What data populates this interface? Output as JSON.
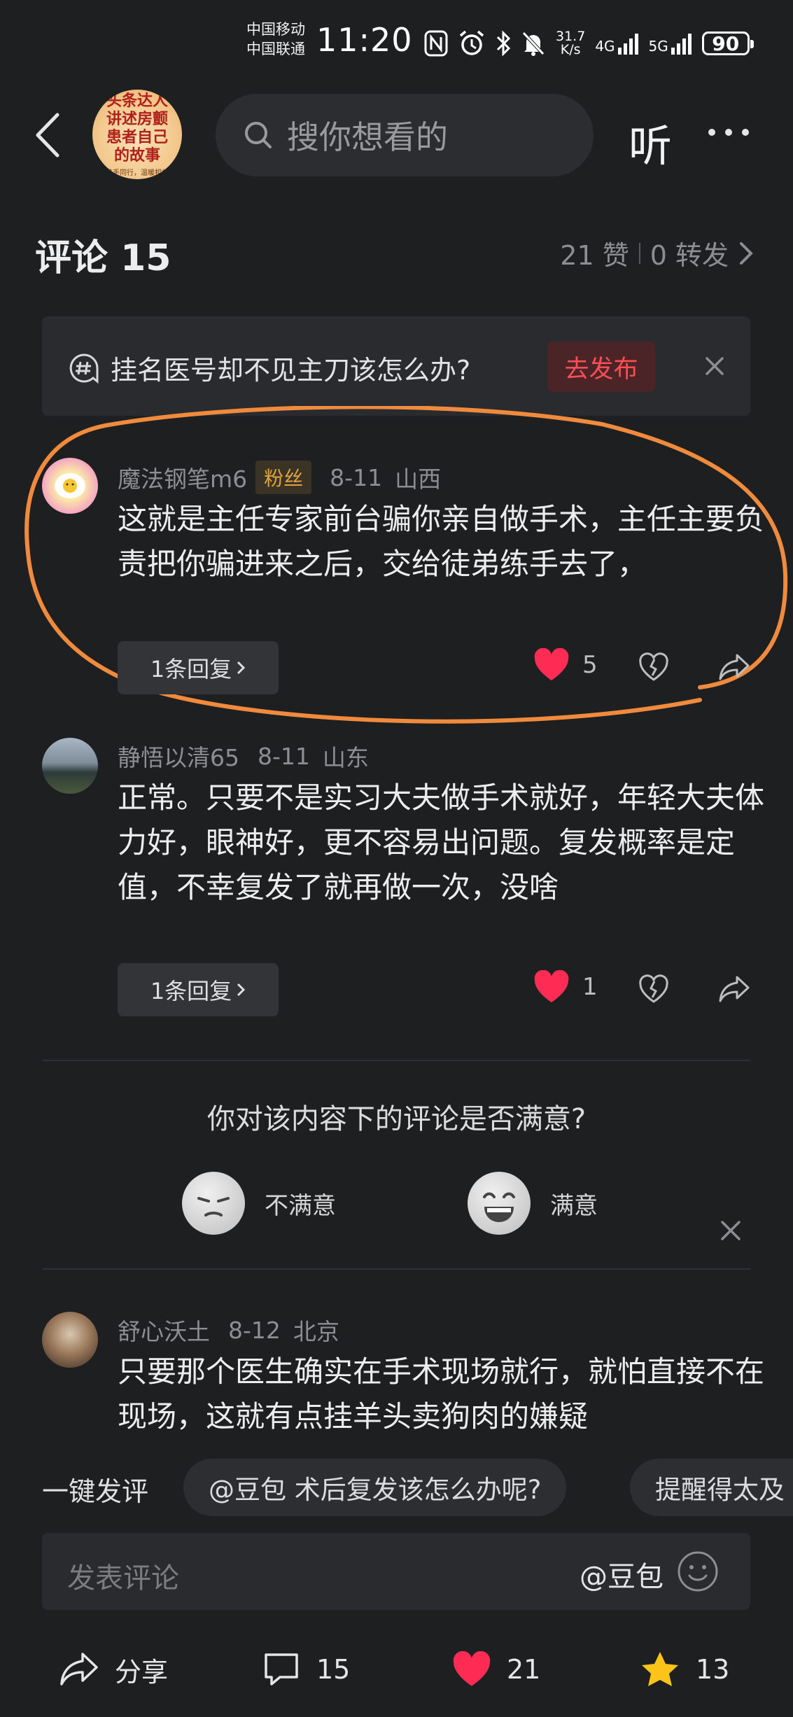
{
  "status_bar": {
    "carrier_1": "中国移动",
    "carrier_2": "中国联通",
    "time": "11:20",
    "net_speed_value": "31.7",
    "net_speed_unit": "K/s",
    "net_type_1": "4G",
    "net_type_2": "5G",
    "battery": "90"
  },
  "header": {
    "cover_title": "头条达人讲述房颤患者自己的故事",
    "cover_subtitle": "携手同行，温暖相伴",
    "search_placeholder": "搜你想看的",
    "listen_label": "听"
  },
  "comments_header": {
    "title": "评论 15",
    "likes": "21 赞",
    "reposts": "0 转发"
  },
  "prompt": {
    "text": "挂名医号却不见主刀该怎么办?",
    "publish_label": "去发布"
  },
  "comments": [
    {
      "user": "魔法钢笔m6",
      "badge": "粉丝",
      "date": "8-11",
      "location": "山西",
      "text": "这就是主任专家前台骗你亲自做手术，主任主要负责把你骗进来之后，交给徒弟练手去了，",
      "reply_label": "1条回复",
      "likes": "5"
    },
    {
      "user": "静悟以清65",
      "date": "8-11",
      "location": "山东",
      "text": "正常。只要不是实习大夫做手术就好，年轻大夫体力好，眼神好，更不容易出问题。复发概率是定值，不幸复发了就再做一次，没啥",
      "reply_label": "1条回复",
      "likes": "1"
    },
    {
      "user": "舒心沃土",
      "date": "8-12",
      "location": "北京",
      "text": "只要那个医生确实在手术现场就行，就怕直接不在现场，这就有点挂羊头卖狗肉的嫌疑"
    }
  ],
  "survey": {
    "question": "你对该内容下的评论是否满意?",
    "option_bad": "不满意",
    "option_good": "满意"
  },
  "quick_comment": {
    "label": "一键发评",
    "chips": [
      "@豆包 术后复发该怎么办呢?",
      "提醒得太及"
    ]
  },
  "composer": {
    "placeholder": "发表评论",
    "doubao": "@豆包"
  },
  "bottom_bar": {
    "share_label": "分享",
    "comments_count": "15",
    "likes_count": "21",
    "favorites_count": "13"
  },
  "colors": {
    "background": "#1e1f21",
    "like_red": "#fe2c55",
    "star_yellow": "#fcc419",
    "highlight_orange": "#f08a3c"
  }
}
